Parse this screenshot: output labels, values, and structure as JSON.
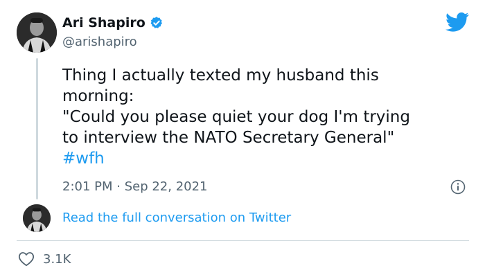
{
  "user": {
    "display_name": "Ari Shapiro",
    "handle": "@arishapiro",
    "verified_icon": "verified-badge-icon"
  },
  "brand": {
    "logo_icon": "twitter-bird-icon",
    "accent": "#1d9bf0"
  },
  "tweet": {
    "lines": [
      "Thing I actually texted my husband this",
      "morning:",
      "\"Could you please quiet your dog I'm trying",
      "to interview the NATO Secretary General\""
    ],
    "hashtag": "#wfh",
    "timestamp": "2:01 PM · Sep 22, 2021"
  },
  "conversation": {
    "read_link": "Read the full conversation on Twitter"
  },
  "engagement": {
    "likes": "3.1K"
  }
}
